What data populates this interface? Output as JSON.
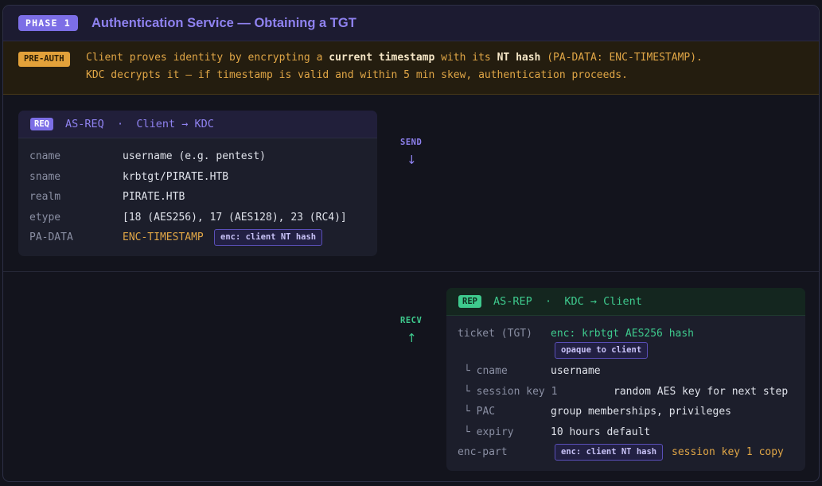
{
  "phase": {
    "badge": "PHASE 1",
    "title": "Authentication Service — Obtaining a TGT"
  },
  "preauth": {
    "badge": "PRE-AUTH",
    "line1_a": "Client proves identity by encrypting a ",
    "line1_bold1": "current timestamp",
    "line1_b": " with its ",
    "line1_bold2": "NT hash",
    "line1_c": " (PA-DATA: ENC-TIMESTAMP).",
    "line2": "KDC decrypts it — if timestamp is valid and within 5 min skew, authentication proceeds."
  },
  "request": {
    "tag": "REQ",
    "title": "AS-REQ  ·  Client → KDC",
    "rows": [
      {
        "key": "cname",
        "value": "username (e.g. pentest)"
      },
      {
        "key": "sname",
        "value": "krbtgt/PIRATE.HTB"
      },
      {
        "key": "realm",
        "value": "PIRATE.HTB"
      },
      {
        "key": "etype",
        "value": "[18 (AES256), 17 (AES128), 23 (RC4)]"
      },
      {
        "key": "PA-DATA",
        "value": "ENC-TIMESTAMP",
        "pill": "enc: client NT hash"
      }
    ]
  },
  "send": {
    "label": "SEND",
    "arrow": "↓"
  },
  "recv": {
    "label": "RECV",
    "arrow": "↑"
  },
  "reply": {
    "tag": "REP",
    "title": "AS-REP  ·  KDC → Client",
    "ticket": {
      "key": "ticket (TGT)",
      "value": "enc: krbtgt AES256 hash",
      "pill": "opaque to client"
    },
    "rows": [
      {
        "key": "└ cname",
        "value": "username"
      },
      {
        "key": "└ session key 1",
        "value": "random AES key for next step"
      },
      {
        "key": "└ PAC",
        "value": "group memberships, privileges"
      },
      {
        "key": "└ expiry",
        "value": "10 hours default"
      }
    ],
    "enc_part": {
      "key": "enc-part",
      "pill": "enc: client NT hash",
      "value": "session key 1 copy"
    }
  }
}
